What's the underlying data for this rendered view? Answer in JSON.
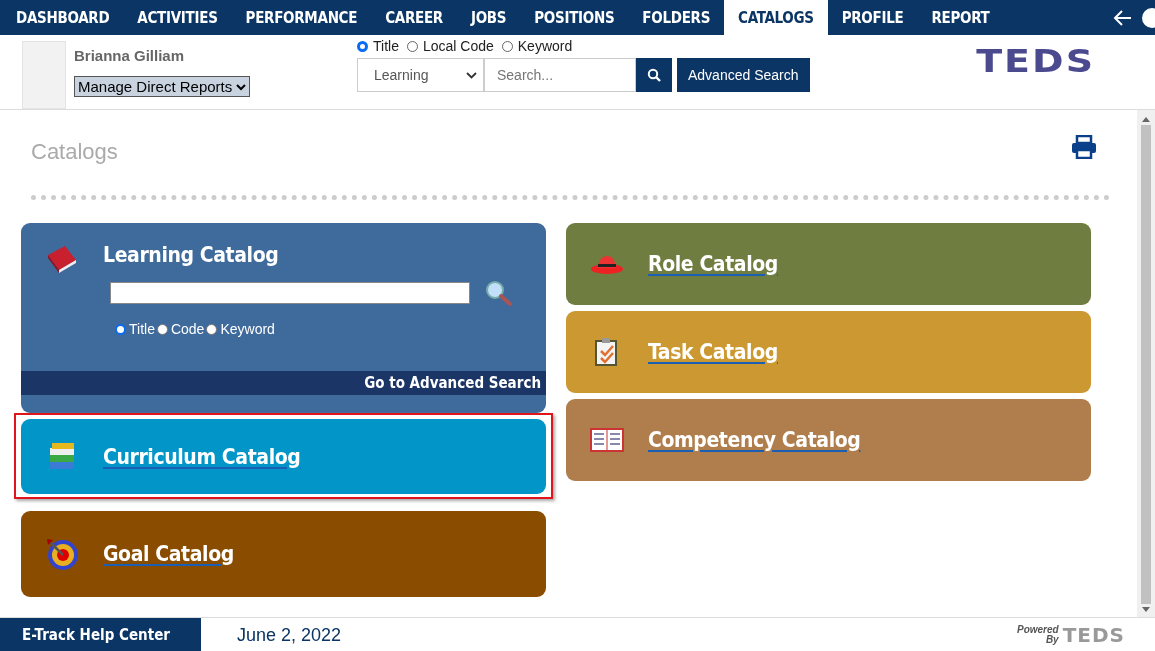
{
  "nav": {
    "items": [
      {
        "label": "DASHBOARD",
        "selected": false
      },
      {
        "label": "ACTIVITIES",
        "selected": false
      },
      {
        "label": "PERFORMANCE",
        "selected": false
      },
      {
        "label": "CAREER",
        "selected": false
      },
      {
        "label": "JOBS",
        "selected": false
      },
      {
        "label": "POSITIONS",
        "selected": false
      },
      {
        "label": "FOLDERS",
        "selected": false
      },
      {
        "label": "CATALOGS",
        "selected": true
      },
      {
        "label": "PROFILE",
        "selected": false
      },
      {
        "label": "REPORT",
        "selected": false
      }
    ]
  },
  "user": {
    "name": "Brianna Gilliam",
    "menu": "Manage Direct Reports"
  },
  "search": {
    "modes": [
      {
        "label": "Title",
        "selected": true
      },
      {
        "label": "Local Code",
        "selected": false
      },
      {
        "label": "Keyword",
        "selected": false
      }
    ],
    "category": "Learning",
    "placeholder": "Search...",
    "button": "Advanced Search"
  },
  "logo": "TEDS",
  "page_title": "Catalogs",
  "left_catalogs": [
    {
      "kind": "search",
      "title": "Learning Catalog",
      "color": "#3f6a9c",
      "highlighted": false,
      "modes": [
        {
          "label": "Title",
          "selected": true
        },
        {
          "label": "Code",
          "selected": false
        },
        {
          "label": "Keyword",
          "selected": false
        }
      ],
      "advanced_link": "Go to Advanced Search"
    },
    {
      "kind": "link",
      "title": "Curriculum Catalog",
      "color": "#0295c8",
      "highlighted": true
    },
    {
      "kind": "link",
      "title": "Goal Catalog",
      "color": "#8a4d00",
      "highlighted": false
    }
  ],
  "right_catalogs": [
    {
      "kind": "link",
      "title": "Role Catalog",
      "color": "#6f7d40",
      "highlighted": false
    },
    {
      "kind": "link",
      "title": "Task Catalog",
      "color": "#cc9832",
      "highlighted": false
    },
    {
      "kind": "link",
      "title": "Competency Catalog",
      "color": "#b07e4d",
      "highlighted": false
    }
  ],
  "footer": {
    "help": "E-Track Help Center",
    "date": "June 2, 2022",
    "powered": "Powered By",
    "logo": "TEDS"
  }
}
